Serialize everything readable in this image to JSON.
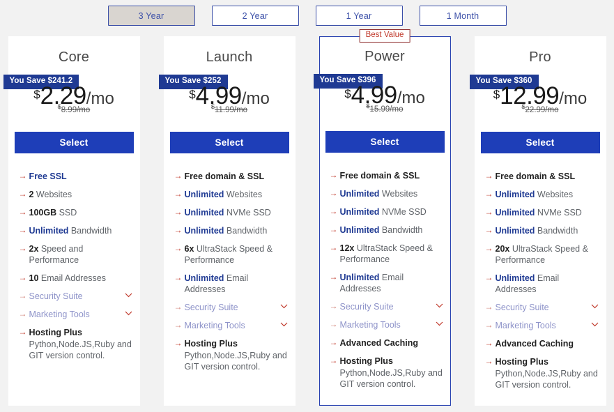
{
  "terms": {
    "tabs": [
      {
        "label": "3 Year",
        "active": true
      },
      {
        "label": "2 Year",
        "active": false
      },
      {
        "label": "1 Year",
        "active": false
      },
      {
        "label": "1 Month",
        "active": false
      }
    ]
  },
  "colors": {
    "badge_blue": "#1f3a93",
    "button_blue": "#1e3eb8",
    "featured_border": "#2741b0",
    "best_value_red": "#c0392b",
    "arrow_red": "#c0392b",
    "page_bg": "#f2f2f2"
  },
  "icons": {
    "arrow": "→",
    "chevron_down": "⌄"
  },
  "plans": [
    {
      "name": "Core",
      "badge": "You Save $241.2",
      "currency": "$",
      "price": "2.29",
      "period": "/mo",
      "old_currency": "$",
      "old_price": "8.99/mo",
      "select_label": "Select",
      "featured": false,
      "best_value_label": "",
      "features": [
        {
          "strong": "Free SSL",
          "rest": "",
          "style": "highlight",
          "chevron": false
        },
        {
          "strong": "2",
          "rest": " Websites",
          "style": "dark",
          "chevron": false
        },
        {
          "strong": "100GB",
          "rest": " SSD",
          "style": "dark",
          "chevron": false
        },
        {
          "strong": "Unlimited",
          "rest": " Bandwidth",
          "style": "highlight",
          "chevron": false
        },
        {
          "strong": "2x",
          "rest": " Speed and Performance",
          "style": "dark",
          "chevron": false
        },
        {
          "strong": "10",
          "rest": " Email Addresses",
          "style": "dark",
          "chevron": false
        },
        {
          "strong": "",
          "rest": "Security Suite",
          "style": "muted",
          "chevron": true
        },
        {
          "strong": "",
          "rest": "Marketing Tools",
          "style": "muted",
          "chevron": true
        },
        {
          "strong": "Hosting Plus",
          "rest": "Python,Node.JS,Ruby and GIT version control.",
          "style": "plus",
          "chevron": false
        }
      ]
    },
    {
      "name": "Launch",
      "badge": "You Save $252",
      "currency": "$",
      "price": "4.99",
      "period": "/mo",
      "old_currency": "$",
      "old_price": "11.99/mo",
      "select_label": "Select",
      "featured": false,
      "best_value_label": "",
      "features": [
        {
          "strong": "Free domain & SSL",
          "rest": "",
          "style": "dark",
          "chevron": false
        },
        {
          "strong": "Unlimited",
          "rest": " Websites",
          "style": "highlight",
          "chevron": false
        },
        {
          "strong": "Unlimited",
          "rest": " NVMe SSD",
          "style": "highlight",
          "chevron": false
        },
        {
          "strong": "Unlimited",
          "rest": " Bandwidth",
          "style": "highlight",
          "chevron": false
        },
        {
          "strong": "6x",
          "rest": " UltraStack Speed & Performance",
          "style": "dark",
          "chevron": false
        },
        {
          "strong": "Unlimited",
          "rest": " Email Addresses",
          "style": "highlight",
          "chevron": false
        },
        {
          "strong": "",
          "rest": "Security Suite",
          "style": "muted",
          "chevron": true
        },
        {
          "strong": "",
          "rest": "Marketing Tools",
          "style": "muted",
          "chevron": true
        },
        {
          "strong": "Hosting Plus",
          "rest": "Python,Node.JS,Ruby and GIT version control.",
          "style": "plus",
          "chevron": false
        }
      ]
    },
    {
      "name": "Power",
      "badge": "You Save $396",
      "currency": "$",
      "price": "4.99",
      "period": "/mo",
      "old_currency": "$",
      "old_price": "15.99/mo",
      "select_label": "Select",
      "featured": true,
      "best_value_label": "Best Value",
      "features": [
        {
          "strong": "Free domain & SSL",
          "rest": "",
          "style": "dark",
          "chevron": false
        },
        {
          "strong": "Unlimited",
          "rest": " Websites",
          "style": "highlight",
          "chevron": false
        },
        {
          "strong": "Unlimited",
          "rest": " NVMe SSD",
          "style": "highlight",
          "chevron": false
        },
        {
          "strong": "Unlimited",
          "rest": " Bandwidth",
          "style": "highlight",
          "chevron": false
        },
        {
          "strong": "12x",
          "rest": " UltraStack Speed & Performance",
          "style": "dark",
          "chevron": false
        },
        {
          "strong": "Unlimited",
          "rest": " Email Addresses",
          "style": "highlight",
          "chevron": false
        },
        {
          "strong": "",
          "rest": "Security Suite",
          "style": "muted",
          "chevron": true
        },
        {
          "strong": "",
          "rest": "Marketing Tools",
          "style": "muted",
          "chevron": true
        },
        {
          "strong": "Advanced Caching",
          "rest": "",
          "style": "dark",
          "chevron": false
        },
        {
          "strong": "Hosting Plus",
          "rest": "Python,Node.JS,Ruby and GIT version control.",
          "style": "plus",
          "chevron": false
        }
      ]
    },
    {
      "name": "Pro",
      "badge": "You Save $360",
      "currency": "$",
      "price": "12.99",
      "period": "/mo",
      "old_currency": "$",
      "old_price": "22.99/mo",
      "select_label": "Select",
      "featured": false,
      "best_value_label": "",
      "features": [
        {
          "strong": "Free domain & SSL",
          "rest": "",
          "style": "dark",
          "chevron": false
        },
        {
          "strong": "Unlimited",
          "rest": " Websites",
          "style": "highlight",
          "chevron": false
        },
        {
          "strong": "Unlimited",
          "rest": " NVMe SSD",
          "style": "highlight",
          "chevron": false
        },
        {
          "strong": "Unlimited",
          "rest": " Bandwidth",
          "style": "highlight",
          "chevron": false
        },
        {
          "strong": "20x",
          "rest": " UltraStack Speed & Performance",
          "style": "dark",
          "chevron": false
        },
        {
          "strong": "Unlimited",
          "rest": " Email Addresses",
          "style": "highlight",
          "chevron": false
        },
        {
          "strong": "",
          "rest": "Security Suite",
          "style": "muted",
          "chevron": true
        },
        {
          "strong": "",
          "rest": "Marketing Tools",
          "style": "muted",
          "chevron": true
        },
        {
          "strong": "Advanced Caching",
          "rest": "",
          "style": "dark",
          "chevron": false
        },
        {
          "strong": "Hosting Plus",
          "rest": "Python,Node.JS,Ruby and GIT version control.",
          "style": "plus",
          "chevron": false
        }
      ]
    }
  ]
}
